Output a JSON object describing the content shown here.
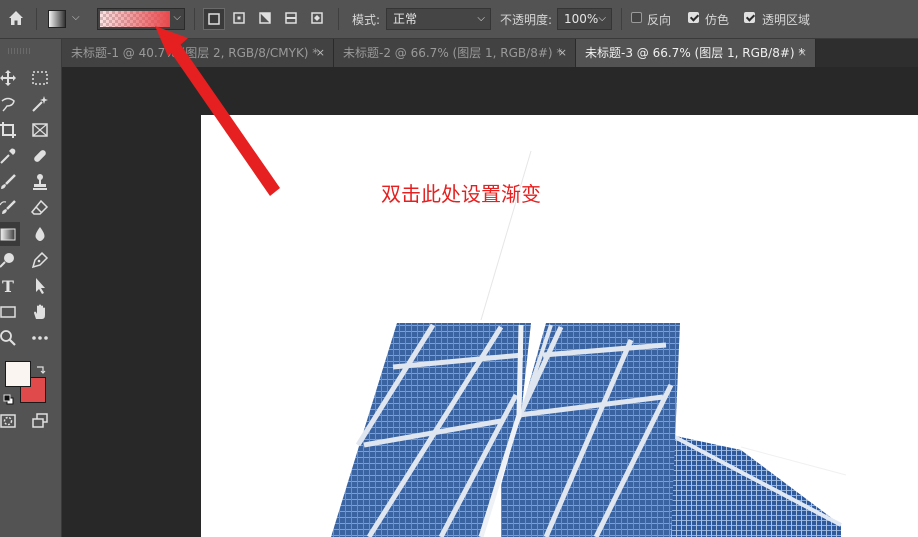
{
  "options_bar": {
    "mode_label": "模式:",
    "mode_value": "正常",
    "opacity_label": "不透明度:",
    "opacity_value": "100%",
    "reverse_label": "反向",
    "reverse_checked": false,
    "dither_label": "仿色",
    "dither_checked": true,
    "transparency_label": "透明区域",
    "transparency_checked": true,
    "gradient_color": "#e8484c"
  },
  "tabs": [
    {
      "label": "未标题-1 @ 40.7% (图层 2, RGB/8/CMYK) *",
      "close": "×",
      "active": false
    },
    {
      "label": "未标题-2 @ 66.7% (图层 1, RGB/8#) *",
      "close": "×",
      "active": false
    },
    {
      "label": "未标题-3 @ 66.7% (图层 1, RGB/8#) *",
      "close": "×",
      "active": true
    }
  ],
  "toolbar": {
    "foreground_color": "#fbf5f2",
    "background_color": "#e04a4a",
    "text_tool_glyph": "T"
  },
  "annotation": {
    "text": "双击此处设置渐变",
    "color": "#e62020"
  }
}
